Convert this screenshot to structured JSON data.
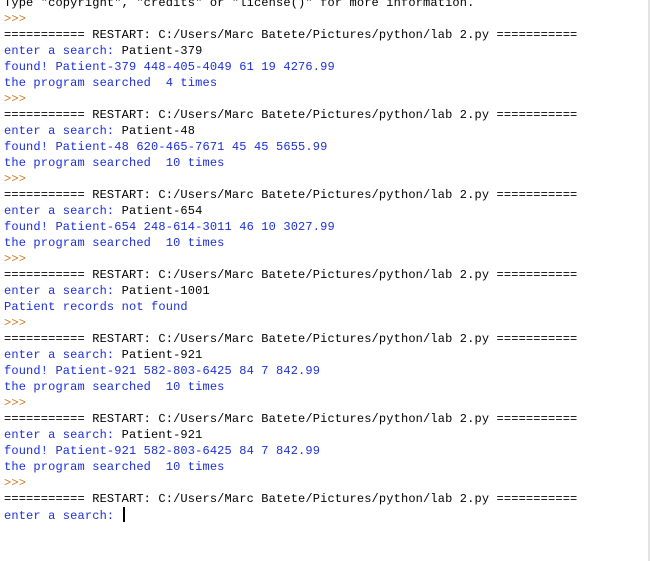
{
  "shell": {
    "header_line": "Type \"copyright\", \"credits\" or \"license()\" for more information.",
    "prompt": ">>>",
    "restart_line": "=========== RESTART: C:/Users/Marc Batete/Pictures/python/lab 2.py ===========",
    "input_label": "enter a search: ",
    "runs": [
      {
        "query": "Patient-379",
        "result": "found! Patient-379 448-405-4049 61 19 4276.99",
        "searched": "the program searched  4 times"
      },
      {
        "query": "Patient-48",
        "result": "found! Patient-48 620-465-7671 45 45 5655.99",
        "searched": "the program searched  10 times"
      },
      {
        "query": "Patient-654",
        "result": "found! Patient-654 248-614-3011 46 10 3027.99",
        "searched": "the program searched  10 times"
      },
      {
        "query": "Patient-1001",
        "result": "Patient records not found",
        "searched": ""
      },
      {
        "query": "Patient-921",
        "result": "found! Patient-921 582-803-6425 84 7 842.99",
        "searched": "the program searched  10 times"
      },
      {
        "query": "Patient-921",
        "result": "found! Patient-921 582-803-6425 84 7 842.99",
        "searched": "the program searched  10 times"
      }
    ],
    "current_input": ""
  },
  "colors": {
    "stdout": "#1a2fd8",
    "prompt": "#c77c2a",
    "text": "#000000",
    "background": "#ffffff"
  }
}
